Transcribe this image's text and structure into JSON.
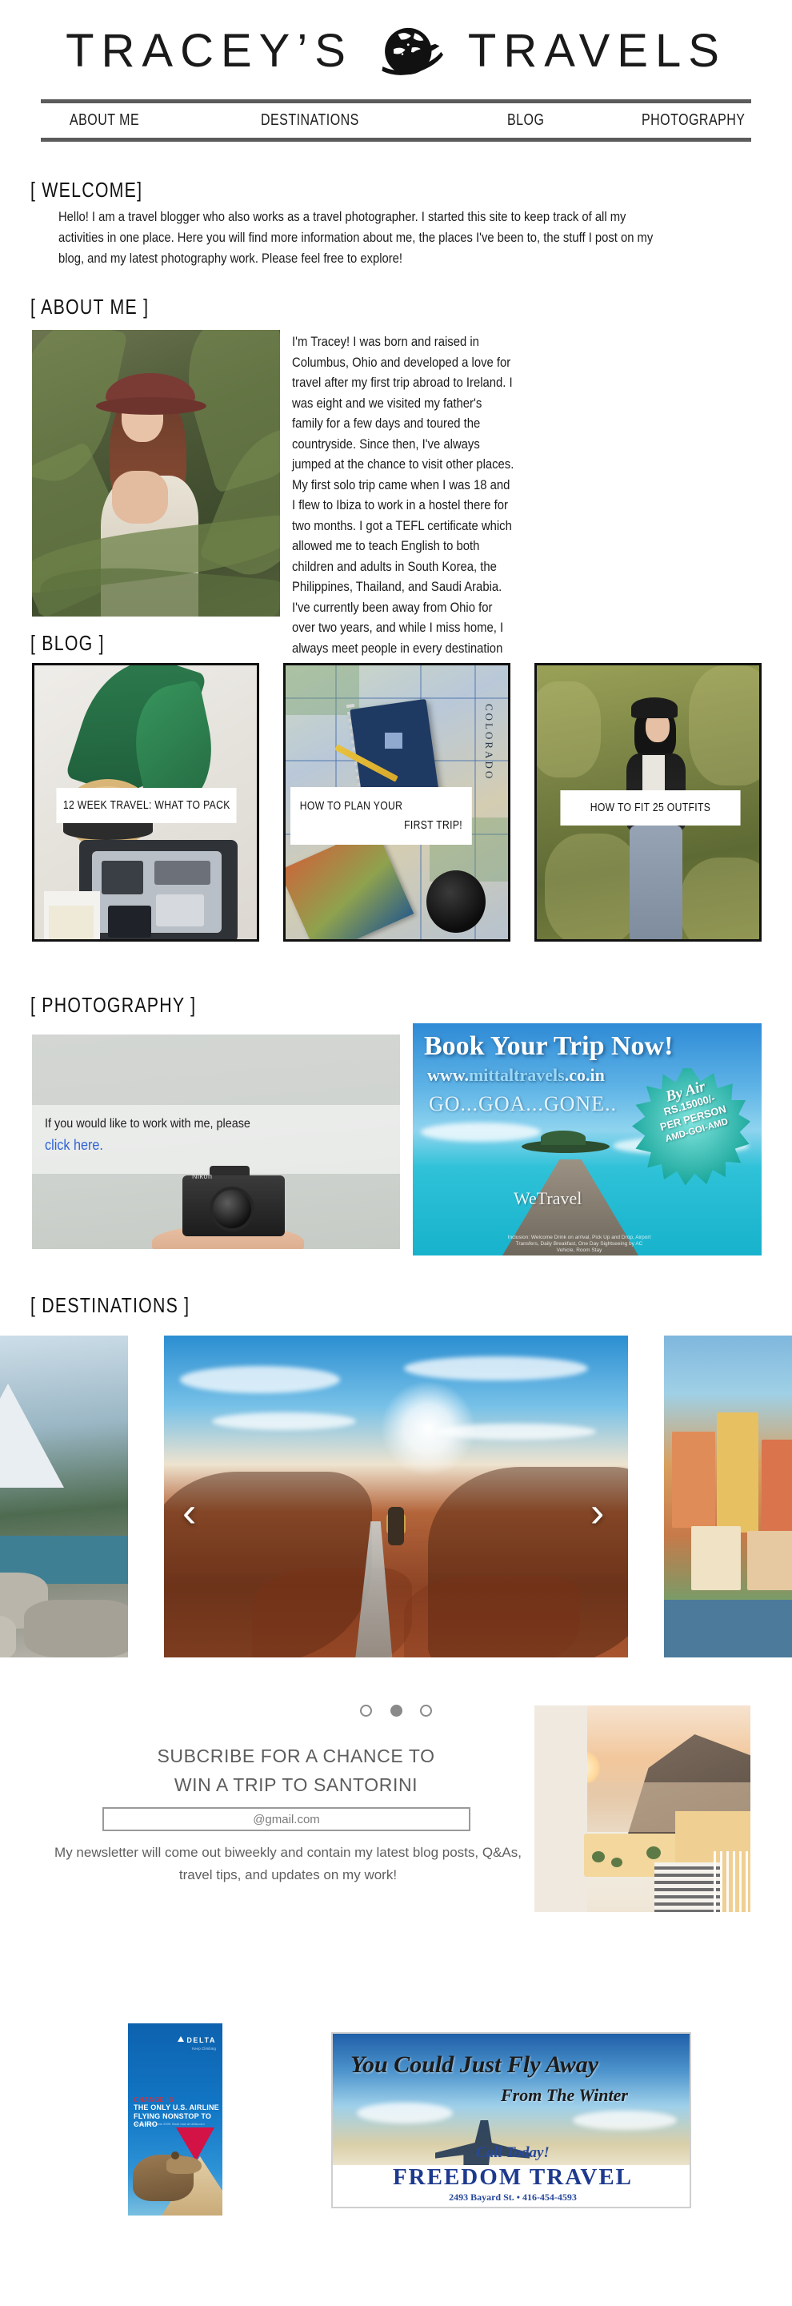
{
  "site": {
    "brand_left": "TRACEY’S",
    "brand_right": "TRAVELS",
    "logo_icon": "globe-airplane-icon"
  },
  "nav": {
    "items": [
      {
        "label": "ABOUT ME"
      },
      {
        "label": "DESTINATIONS"
      },
      {
        "label": "BLOG"
      },
      {
        "label": "PHOTOGRAPHY"
      }
    ]
  },
  "welcome": {
    "heading": "[ WELCOME]",
    "body": "Hello! I am a travel blogger who also works as a travel photographer. I started this site to keep track of all my activities in one place. Here you will find more information about me, the places I've been to, the stuff I post on my blog, and my latest photography work. Please feel free to explore!"
  },
  "about": {
    "heading": "[ ABOUT ME ]",
    "photo_alt": "portrait-woman-in-hat-cornfield",
    "body": "I'm Tracey! I was born and raised in Columbus, Ohio and developed a love for travel after my first trip abroad to Ireland. I was eight and we visited my father's family for a few days and toured the countryside. Since then, I've always jumped at the chance to visit other places. My first solo trip came when I was 18 and I flew to Ibiza to work in a hostel there for two months. I got a TEFL certificate which allowed me to teach English to both children and adults in South Korea, the Philippines, Thailand, and Saudi Arabia. I've currently been away from Ohio for over two years, and while I miss home, I always meet people in every destination who make each new city feel like home."
  },
  "blog": {
    "heading": "[ BLOG ]",
    "cards": [
      {
        "title": "12 WEEK TRAVEL: WHAT TO PACK",
        "image_alt": "flatlay-suitcase-hat-leaves"
      },
      {
        "title_line1": "HOW TO PLAN YOUR",
        "title_line2": "FIRST TRIP!",
        "image_alt": "map-notebook-pencil-colorado"
      },
      {
        "title": "HOW TO FIT 25 OUTFITS",
        "image_alt": "woman-in-black-hat-field"
      }
    ]
  },
  "photography": {
    "heading": "[ PHOTOGRAPHY ]",
    "cta_text": "If you would like to work with me, please",
    "cta_link": "click here.",
    "cta_link_color": "#2f63d8",
    "cta_image_alt": "hand-holding-nikon-camera",
    "ad": {
      "title": "Book Your Trip Now!",
      "url_prefix": "www.",
      "url_highlight": "mittaltravels",
      "url_suffix": ".co.in",
      "tagline": "GO...GOA...GONE..",
      "badge_line1": "By Air",
      "badge_line2": "RS.15000/-",
      "badge_line3": "PER PERSON",
      "badge_line4": "AMD-GOI-AMD",
      "watermark": "WeTravel"
    }
  },
  "destinations": {
    "heading": "[ DESTINATIONS ]",
    "prev_arrow": "‹",
    "next_arrow": "›",
    "slides": [
      {
        "alt": "mountain-lake-rocks"
      },
      {
        "alt": "red-canyon-hiker-sunburst"
      },
      {
        "alt": "colorful-cliffside-village"
      }
    ],
    "active_index": 1,
    "dots": [
      {
        "active": false
      },
      {
        "active": true
      },
      {
        "active": false
      }
    ]
  },
  "subscribe": {
    "title_line1": "SUBCRIBE FOR A CHANCE TO",
    "title_line2": "WIN A TRIP TO SANTORINI",
    "input_value": "",
    "input_placeholder": "@gmail.com",
    "note": "My newsletter will come out biweekly and contain my latest blog posts, Q&As, travel tips, and updates on my work!",
    "image_alt": "santorini-sunset-stairs"
  },
  "ads": {
    "delta": {
      "brand": "DELTA",
      "brand_sub": "Keep Climbing",
      "eyebrow": "CHANGE IS",
      "line1": "THE ONLY U.S. AIRLINE",
      "line2": "FLYING NONSTOP TO CAIRO",
      "fineprint": "Service begins June 2009. Book now at delta.com",
      "image_alt": "camel-and-pyramid"
    },
    "freedom": {
      "line1": "You Could Just Fly Away",
      "line2": "From The Winter",
      "call": "Call Today!",
      "name": "FREEDOM TRAVEL",
      "address": "2493 Bayard St. • 416-454-4593",
      "image_alt": "airplane-silhouette-sky"
    }
  }
}
